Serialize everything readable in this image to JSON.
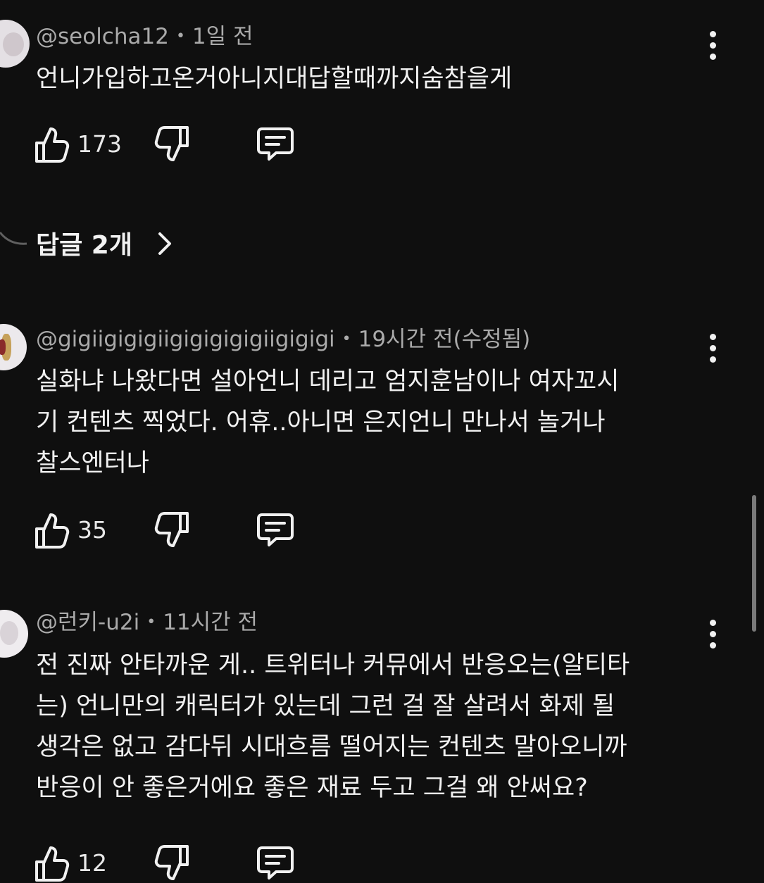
{
  "comments": [
    {
      "author": "@seolcha12",
      "time": "1일 전",
      "text": "언니가입하고온거아니지대답할때까지숨참을게",
      "likes": "173",
      "replies_label": "답글 2개"
    },
    {
      "author": "@gigiigigigiigigigigigiigigigi",
      "time": "19시간 전(수정됨)",
      "text": "실화냐 나왔다면 설아언니 데리고 엄지훈남이나 여자꼬시\n기 컨텐츠 찍었다. 어휴..아니면 은지언니 만나서 놀거나\n찰스엔터나",
      "likes": "35"
    },
    {
      "author": "@런키-u2i",
      "time": "11시간 전",
      "text": "전 진짜 안타까운 게.. 트위터나 커뮤에서 반응오는(알티타\n는) 언니만의 캐릭터가 있는데 그런 걸 잘 살려서 화제 될\n생각은 없고 감다뒤 시대흐름 떨어지는 컨텐츠 말아오니까\n반응이 안 좋은거에요 좋은 재료 두고 그걸 왜 안써요?",
      "likes": "12"
    }
  ],
  "separator": "•",
  "icons": {
    "like": "thumb-up-icon",
    "dislike": "thumb-down-icon",
    "reply": "comment-reply-icon",
    "more": "more-vert-icon",
    "chevron": "chevron-right-icon"
  },
  "colors": {
    "background": "#0f0f0f",
    "text": "#f1f1f1",
    "meta": "#aaaaaa"
  }
}
